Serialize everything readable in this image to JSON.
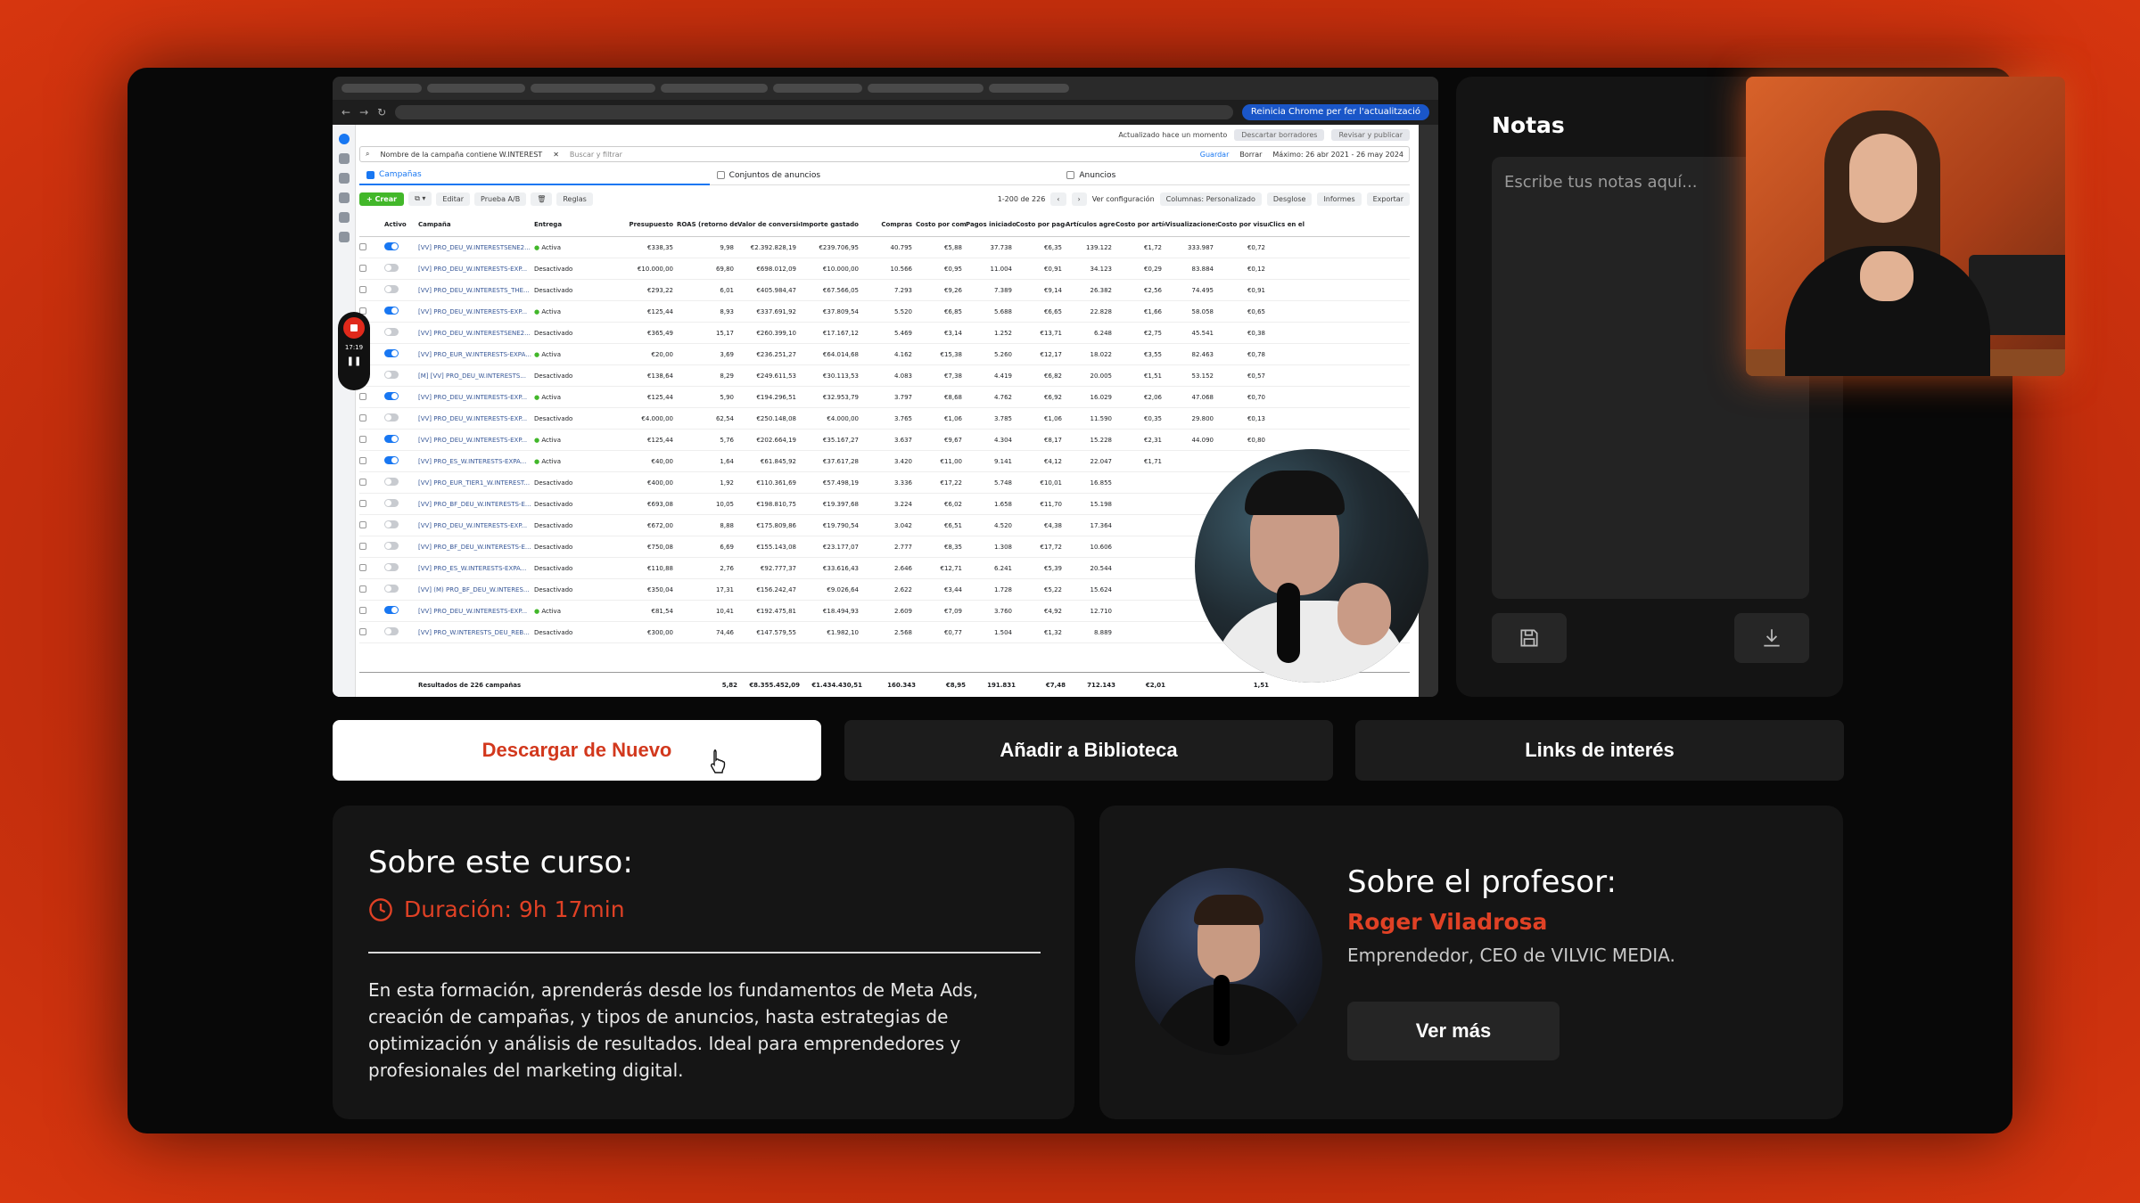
{
  "colors": {
    "accent": "#e04125",
    "background": "#080808",
    "card": "#151515"
  },
  "browser": {
    "reinicia": "Reinicia Chrome per fer l'actualització"
  },
  "ads_manager": {
    "updated": "Actualizado hace un momento",
    "discard": "Descartar borradores",
    "review": "Revisar y publicar",
    "filter": "Nombre de la campaña contiene W.INTEREST",
    "search_placeholder": "Buscar y filtrar",
    "save": "Guardar",
    "clear": "Borrar",
    "date_range": "Máximo: 26 abr 2021 - 26 may 2024",
    "tabs": [
      "Campañas",
      "Conjuntos de anuncios",
      "Anuncios"
    ],
    "toolbar": {
      "create": "+ Crear",
      "edit": "Editar",
      "ab": "Prueba A/B",
      "rules": "Reglas",
      "range": "1-200 de 226",
      "config": "Ver configuración",
      "columns": "Columnas: Personalizado",
      "breakdown": "Desglose",
      "reports": "Informes",
      "export": "Exportar"
    },
    "headers": [
      "",
      "Activo",
      "Campaña",
      "Entrega",
      "Presupuesto",
      "ROAS (retorno de la inversión en publicidad...",
      "Valor de conversión de compras",
      "Importe gastado",
      "Compras",
      "Costo por compra",
      "Pagos iniciados",
      "Costo por pago iniciado",
      "Artículos agregados al carrito",
      "Costo por artículo agregado al...",
      "Visualizaciones de contenido",
      "Costo por visualización de contenido",
      "Clics en el enlace"
    ],
    "rows": [
      {
        "on": true,
        "name": "[VV] PRO_DEU_W.INTERESTSENE2...",
        "status": "Activa",
        "budget": "€338,35",
        "roas": "9,98",
        "value": "€2.392.828,19",
        "spent": "€239.706,95",
        "purchases": "40.795",
        "cpp": "€5,88",
        "checkouts": "37.738",
        "cpc": "€6,35",
        "cart": "139.122",
        "cpa": "€1,72",
        "views": "333.987",
        "cpv": "€0,72"
      },
      {
        "on": false,
        "name": "[VV] PRO_DEU_W.INTERESTS-EXP...",
        "status": "Desactivado",
        "budget": "€10.000,00",
        "roas": "69,80",
        "value": "€698.012,09",
        "spent": "€10.000,00",
        "purchases": "10.566",
        "cpp": "€0,95",
        "checkouts": "11.004",
        "cpc": "€0,91",
        "cart": "34.123",
        "cpa": "€0,29",
        "views": "83.884",
        "cpv": "€0,12"
      },
      {
        "on": false,
        "name": "[VV] PRO_DEU_W.INTERESTS_THE...",
        "status": "Desactivado",
        "budget": "€293,22",
        "roas": "6,01",
        "value": "€405.984,47",
        "spent": "€67.566,05",
        "purchases": "7.293",
        "cpp": "€9,26",
        "checkouts": "7.389",
        "cpc": "€9,14",
        "cart": "26.382",
        "cpa": "€2,56",
        "views": "74.495",
        "cpv": "€0,91"
      },
      {
        "on": true,
        "name": "[VV] PRO_DEU_W.INTERESTS-EXP...",
        "status": "Activa",
        "budget": "€125,44",
        "roas": "8,93",
        "value": "€337.691,92",
        "spent": "€37.809,54",
        "purchases": "5.520",
        "cpp": "€6,85",
        "checkouts": "5.688",
        "cpc": "€6,65",
        "cart": "22.828",
        "cpa": "€1,66",
        "views": "58.058",
        "cpv": "€0,65"
      },
      {
        "on": false,
        "name": "[VV] PRO_DEU_W.INTERESTSENE2...",
        "status": "Desactivado",
        "budget": "€365,49",
        "roas": "15,17",
        "value": "€260.399,10",
        "spent": "€17.167,12",
        "purchases": "5.469",
        "cpp": "€3,14",
        "checkouts": "1.252",
        "cpc": "€13,71",
        "cart": "6.248",
        "cpa": "€2,75",
        "views": "45.541",
        "cpv": "€0,38"
      },
      {
        "on": true,
        "name": "[VV] PRO_EUR_W.INTERESTS-EXPA...",
        "status": "Activa",
        "budget": "€20,00",
        "roas": "3,69",
        "value": "€236.251,27",
        "spent": "€64.014,68",
        "purchases": "4.162",
        "cpp": "€15,38",
        "checkouts": "5.260",
        "cpc": "€12,17",
        "cart": "18.022",
        "cpa": "€3,55",
        "views": "82.463",
        "cpv": "€0,78"
      },
      {
        "on": false,
        "name": "[M] [VV] PRO_DEU_W.INTERESTS...",
        "status": "Desactivado",
        "budget": "€138,64",
        "roas": "8,29",
        "value": "€249.611,53",
        "spent": "€30.113,53",
        "purchases": "4.083",
        "cpp": "€7,38",
        "checkouts": "4.419",
        "cpc": "€6,82",
        "cart": "20.005",
        "cpa": "€1,51",
        "views": "53.152",
        "cpv": "€0,57"
      },
      {
        "on": true,
        "name": "[VV] PRO_DEU_W.INTERESTS-EXP...",
        "status": "Activa",
        "budget": "€125,44",
        "roas": "5,90",
        "value": "€194.296,51",
        "spent": "€32.953,79",
        "purchases": "3.797",
        "cpp": "€8,68",
        "checkouts": "4.762",
        "cpc": "€6,92",
        "cart": "16.029",
        "cpa": "€2,06",
        "views": "47.068",
        "cpv": "€0,70"
      },
      {
        "on": false,
        "name": "[VV] PRO_DEU_W.INTERESTS-EXP...",
        "status": "Desactivado",
        "budget": "€4.000,00",
        "roas": "62,54",
        "value": "€250.148,08",
        "spent": "€4.000,00",
        "purchases": "3.765",
        "cpp": "€1,06",
        "checkouts": "3.785",
        "cpc": "€1,06",
        "cart": "11.590",
        "cpa": "€0,35",
        "views": "29.800",
        "cpv": "€0,13"
      },
      {
        "on": true,
        "name": "[VV] PRO_DEU_W.INTERESTS-EXP...",
        "status": "Activa",
        "budget": "€125,44",
        "roas": "5,76",
        "value": "€202.664,19",
        "spent": "€35.167,27",
        "purchases": "3.637",
        "cpp": "€9,67",
        "checkouts": "4.304",
        "cpc": "€8,17",
        "cart": "15.228",
        "cpa": "€2,31",
        "views": "44.090",
        "cpv": "€0,80"
      },
      {
        "on": true,
        "name": "[VV] PRO_ES_W.INTERESTS-EXPA...",
        "status": "Activa",
        "budget": "€40,00",
        "roas": "1,64",
        "value": "€61.845,92",
        "spent": "€37.617,28",
        "purchases": "3.420",
        "cpp": "€11,00",
        "checkouts": "9.141",
        "cpc": "€4,12",
        "cart": "22.047",
        "cpa": "€1,71",
        "views": "",
        "cpv": ""
      },
      {
        "on": false,
        "name": "[VV] PRO_EUR_TIER1_W.INTEREST...",
        "status": "Desactivado",
        "budget": "€400,00",
        "roas": "1,92",
        "value": "€110.361,69",
        "spent": "€57.498,19",
        "purchases": "3.336",
        "cpp": "€17,22",
        "checkouts": "5.748",
        "cpc": "€10,01",
        "cart": "16.855",
        "cpa": "",
        "views": "",
        "cpv": ""
      },
      {
        "on": false,
        "name": "[VV] PRO_BF_DEU_W.INTERESTS-E...",
        "status": "Desactivado",
        "budget": "€693,08",
        "roas": "10,05",
        "value": "€198.810,75",
        "spent": "€19.397,68",
        "purchases": "3.224",
        "cpp": "€6,02",
        "checkouts": "1.658",
        "cpc": "€11,70",
        "cart": "15.198",
        "cpa": "",
        "views": "",
        "cpv": ""
      },
      {
        "on": false,
        "name": "[VV] PRO_DEU_W.INTERESTS-EXP...",
        "status": "Desactivado",
        "budget": "€672,00",
        "roas": "8,88",
        "value": "€175.809,86",
        "spent": "€19.790,54",
        "purchases": "3.042",
        "cpp": "€6,51",
        "checkouts": "4.520",
        "cpc": "€4,38",
        "cart": "17.364",
        "cpa": "",
        "views": "",
        "cpv": ""
      },
      {
        "on": false,
        "name": "[VV] PRO_BF_DEU_W.INTERESTS-E...",
        "status": "Desactivado",
        "budget": "€750,08",
        "roas": "6,69",
        "value": "€155.143,08",
        "spent": "€23.177,07",
        "purchases": "2.777",
        "cpp": "€8,35",
        "checkouts": "1.308",
        "cpc": "€17,72",
        "cart": "10.606",
        "cpa": "",
        "views": "",
        "cpv": ""
      },
      {
        "on": false,
        "name": "[VV] PRO_ES_W.INTERESTS-EXPA...",
        "status": "Desactivado",
        "budget": "€110,88",
        "roas": "2,76",
        "value": "€92.777,37",
        "spent": "€33.616,43",
        "purchases": "2.646",
        "cpp": "€12,71",
        "checkouts": "6.241",
        "cpc": "€5,39",
        "cart": "20.544",
        "cpa": "",
        "views": "",
        "cpv": ""
      },
      {
        "on": false,
        "name": "[VV] (M) PRO_BF_DEU_W.INTERES...",
        "status": "Desactivado",
        "budget": "€350,04",
        "roas": "17,31",
        "value": "€156.242,47",
        "spent": "€9.026,64",
        "purchases": "2.622",
        "cpp": "€3,44",
        "checkouts": "1.728",
        "cpc": "€5,22",
        "cart": "15.624",
        "cpa": "",
        "views": "",
        "cpv": ""
      },
      {
        "on": true,
        "name": "[VV] PRO_DEU_W.INTERESTS-EXP...",
        "status": "Activa",
        "budget": "€81,54",
        "roas": "10,41",
        "value": "€192.475,81",
        "spent": "€18.494,93",
        "purchases": "2.609",
        "cpp": "€7,09",
        "checkouts": "3.760",
        "cpc": "€4,92",
        "cart": "12.710",
        "cpa": "",
        "views": "",
        "cpv": ""
      },
      {
        "on": false,
        "name": "[VV] PRO_W.INTERESTS_DEU_REB...",
        "status": "Desactivado",
        "budget": "€300,00",
        "roas": "74,46",
        "value": "€147.579,55",
        "spent": "€1.982,10",
        "purchases": "2.568",
        "cpp": "€0,77",
        "checkouts": "1.504",
        "cpc": "€1,32",
        "cart": "8.889",
        "cpa": "",
        "views": "",
        "cpv": ""
      }
    ],
    "total": {
      "label": "Resultados de 226 campañas",
      "roas": "5,82",
      "value": "€8.355.452,09",
      "spent": "€1.434.430,51",
      "purchases": "160.343",
      "cpp": "€8,95",
      "checkouts": "191.831",
      "cpc": "€7,48",
      "cart": "712.143",
      "cpa": "€2,01",
      "clicks": "1,51"
    }
  },
  "recorder": {
    "time": "17:19"
  },
  "notes": {
    "title": "Notas",
    "placeholder": "Escribe tus notas aquí..."
  },
  "actions": {
    "download_again": "Descargar de Nuevo",
    "add_library": "Añadir a Biblioteca",
    "links": "Links de interés"
  },
  "course": {
    "heading": "Sobre este curso:",
    "duration": "Duración: 9h 17min",
    "description": "En esta formación, aprenderás desde los fundamentos de Meta Ads, creación de campañas, y tipos de anuncios, hasta estrategias de optimización y análisis de resultados. Ideal para emprendedores y profesionales del marketing digital."
  },
  "professor": {
    "heading": "Sobre el profesor:",
    "name": "Roger Viladrosa",
    "role": "Emprendedor, CEO de VILVIC MEDIA.",
    "more": "Ver más"
  }
}
